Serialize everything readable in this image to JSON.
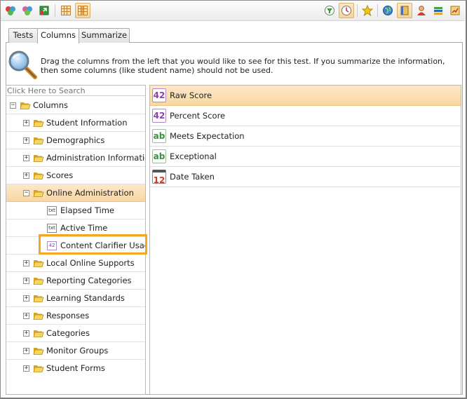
{
  "toolbar": {
    "left_icons": [
      "people-color-icon",
      "people-group-icon",
      "export-icon",
      "grid-icon",
      "grid-columns-icon"
    ],
    "right_icons": [
      "filter-icon",
      "clock-icon",
      "star-icon",
      "globe-icon",
      "book-icon",
      "user-icon",
      "books-icon",
      "report-icon"
    ]
  },
  "tabs": [
    {
      "label": "Tests",
      "active": false
    },
    {
      "label": "Columns",
      "active": true
    },
    {
      "label": "Summarize",
      "active": false
    }
  ],
  "help_text": "Drag the columns from the left that you would like to see for this test. If you summarize the information, then some columns (like student name) should not be used.",
  "search": {
    "placeholder": "Click Here to Search"
  },
  "tree": {
    "root": "Columns",
    "items": [
      {
        "label": "Student Information",
        "type": "folder",
        "expanded": false
      },
      {
        "label": "Demographics",
        "type": "folder",
        "expanded": false
      },
      {
        "label": "Administration Information",
        "type": "folder",
        "expanded": false
      },
      {
        "label": "Scores",
        "type": "folder",
        "expanded": false
      },
      {
        "label": "Online Administration",
        "type": "folder",
        "expanded": true,
        "selected": true
      },
      {
        "label": "Elapsed Time",
        "type": "txt",
        "icon_text": "txt"
      },
      {
        "label": "Active Time",
        "type": "txt",
        "icon_text": "txt"
      },
      {
        "label": "Content Clarifier Usage",
        "type": "num",
        "icon_text": "42"
      },
      {
        "label": "Local Online Supports",
        "type": "folder",
        "expanded": false
      },
      {
        "label": "Reporting Categories",
        "type": "folder",
        "expanded": false
      },
      {
        "label": "Learning Standards",
        "type": "folder",
        "expanded": false
      },
      {
        "label": "Responses",
        "type": "folder",
        "expanded": false
      },
      {
        "label": "Categories",
        "type": "folder",
        "expanded": false
      },
      {
        "label": "Monitor Groups",
        "type": "folder",
        "expanded": false
      },
      {
        "label": "Student Forms",
        "type": "folder",
        "expanded": false
      }
    ]
  },
  "selected_columns": [
    {
      "label": "Raw Score",
      "type": "num",
      "icon_text": "42",
      "selected": true
    },
    {
      "label": "Percent Score",
      "type": "num",
      "icon_text": "42"
    },
    {
      "label": "Meets Expectation",
      "type": "text",
      "icon_text": "ab"
    },
    {
      "label": "Exceptional",
      "type": "text",
      "icon_text": "ab"
    },
    {
      "label": "Date Taken",
      "type": "date",
      "icon_text": "12"
    }
  ],
  "colors": {
    "selected": "#f9d7a3",
    "highlight": "#f5a623",
    "folder": "#f2c94c",
    "number_icon": "#8c3fae",
    "text_icon": "#3c8f3c",
    "date_icon": "#d03a2a"
  }
}
